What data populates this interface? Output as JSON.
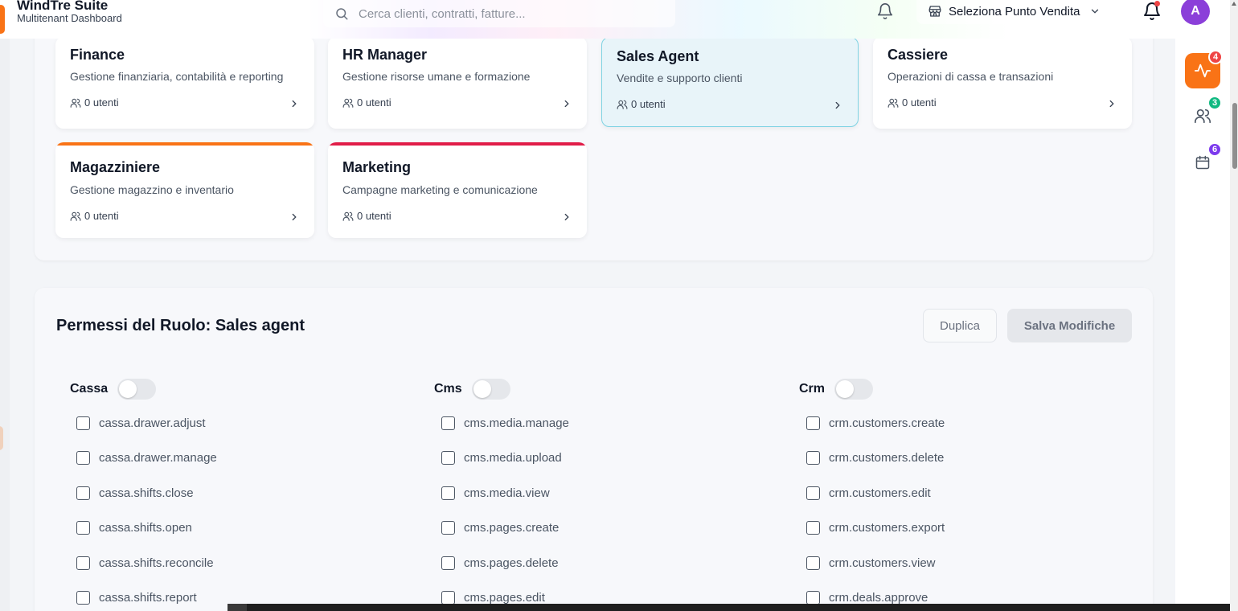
{
  "header": {
    "brand_title": "WindTre Suite",
    "brand_subtitle": "Multitenant Dashboard",
    "search_placeholder": "Cerca clienti, contratti, fatture...",
    "store_select_label": "Seleziona Punto Vendita",
    "avatar_initial": "A",
    "accent_color": "#f97316"
  },
  "right_rail": {
    "items": [
      {
        "icon": "activity-icon",
        "badge": "4",
        "badge_color": "#ef4444"
      },
      {
        "icon": "users-icon",
        "badge": "3",
        "badge_color": "#10b981"
      },
      {
        "icon": "calendar-icon",
        "badge": "6",
        "badge_color": "#7c3aed"
      }
    ]
  },
  "roles": [
    {
      "name": "Finance",
      "description": "Gestione finanziaria, contabilità e reporting",
      "users": "0 utenti"
    },
    {
      "name": "HR Manager",
      "description": "Gestione risorse umane e formazione",
      "users": "0 utenti"
    },
    {
      "name": "Sales Agent",
      "description": "Vendite e supporto clienti",
      "users": "0 utenti",
      "selected": true
    },
    {
      "name": "Cassiere",
      "description": "Operazioni di cassa e transazioni",
      "users": "0 utenti"
    },
    {
      "name": "Magazziniere",
      "description": "Gestione magazzino e inventario",
      "users": "0 utenti",
      "stripe_color": "#f97316"
    },
    {
      "name": "Marketing",
      "description": "Campagne marketing e comunicazione",
      "users": "0 utenti",
      "stripe_color": "#e11d48"
    }
  ],
  "permissions": {
    "title": "Permessi del Ruolo: Sales agent",
    "duplicate_label": "Duplica",
    "save_label": "Salva Modifiche",
    "groups": [
      {
        "name": "Cassa",
        "enabled": false,
        "items": [
          "cassa.drawer.adjust",
          "cassa.drawer.manage",
          "cassa.shifts.close",
          "cassa.shifts.open",
          "cassa.shifts.reconcile",
          "cassa.shifts.report"
        ]
      },
      {
        "name": "Cms",
        "enabled": false,
        "items": [
          "cms.media.manage",
          "cms.media.upload",
          "cms.media.view",
          "cms.pages.create",
          "cms.pages.delete",
          "cms.pages.edit"
        ]
      },
      {
        "name": "Crm",
        "enabled": false,
        "items": [
          "crm.customers.create",
          "crm.customers.delete",
          "crm.customers.edit",
          "crm.customers.export",
          "crm.customers.view",
          "crm.deals.approve"
        ]
      }
    ]
  }
}
